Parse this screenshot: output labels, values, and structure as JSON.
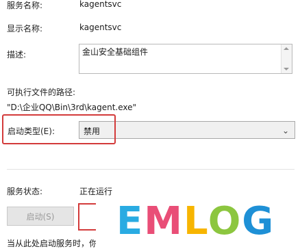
{
  "fields": {
    "service_name_label": "服务名称:",
    "service_name_value": "kagentsvc",
    "display_name_label": "显示名称:",
    "display_name_value": "kagentsvc",
    "description_label": "描述:",
    "description_value": "金山安全基础组件",
    "exe_path_label": "可执行文件的路径:",
    "exe_path_value": "\"D:\\企业QQ\\Bin\\3rd\\kagent.exe\"",
    "startup_type_label": "启动类型(E):",
    "startup_type_value": "禁用",
    "service_status_label": "服务状态:",
    "service_status_value": "正在运行"
  },
  "buttons": {
    "start_label": "启动(S)"
  },
  "footer": {
    "hint_text": "当从此处启动服务时，你"
  },
  "watermark": {
    "letters": [
      "E",
      "M",
      "L",
      "O",
      "G"
    ],
    "colors": [
      "#29abe2",
      "#e94e77",
      "#f7b500",
      "#8cc63f",
      "#1e90d6"
    ]
  },
  "accent": {
    "highlight": "#d33a3a"
  }
}
